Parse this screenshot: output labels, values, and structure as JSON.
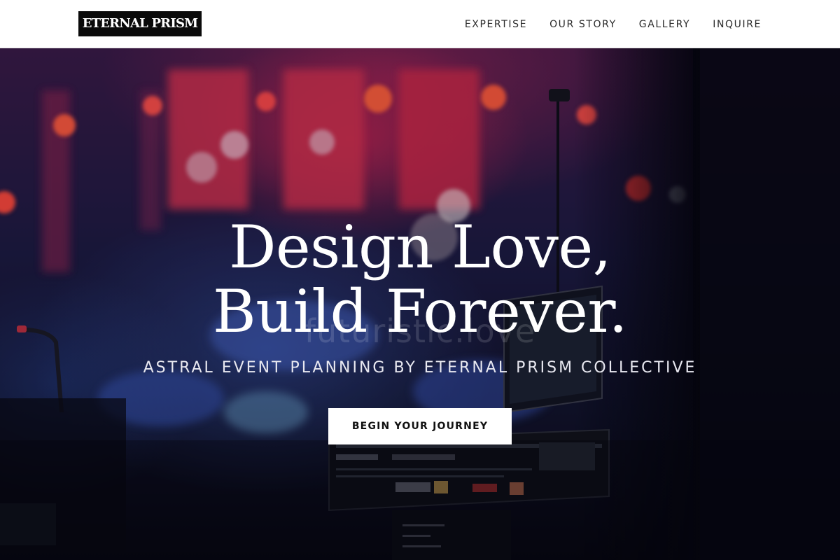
{
  "header": {
    "logo_text": "ETERNAL PRISM",
    "nav": [
      {
        "label": "EXPERTISE"
      },
      {
        "label": "OUR STORY"
      },
      {
        "label": "GALLERY"
      },
      {
        "label": "INQUIRE"
      }
    ]
  },
  "hero": {
    "headline_line1": "Design Love,",
    "headline_line2": "Build Forever.",
    "watermark_text": "futuristic.love",
    "tagline": "ASTRAL EVENT PLANNING BY ETERNAL PRISM COLLECTIVE",
    "cta_label": "BEGIN YOUR JOURNEY",
    "background_image": "concert-stage-mixing-console-photo"
  },
  "colors": {
    "header_bg": "#ffffff",
    "logo_bg": "#0a0a0a",
    "nav_text": "#2a2a2a",
    "hero_text": "#ffffff",
    "cta_bg": "#ffffff",
    "cta_text": "#111111"
  }
}
